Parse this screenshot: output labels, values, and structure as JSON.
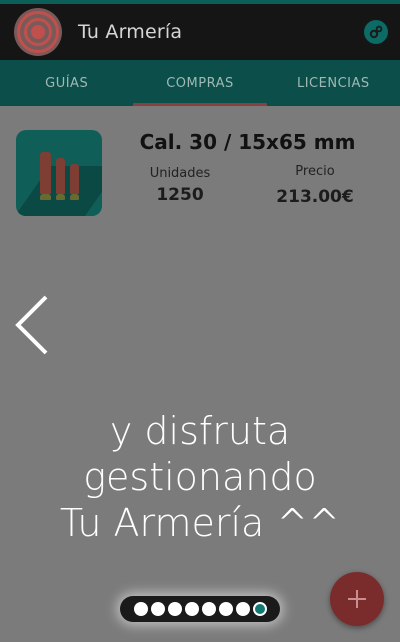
{
  "app": {
    "title": "Tu Armería",
    "logo_icon": "target-icon",
    "settings_icon": "gears-icon"
  },
  "tabs": [
    {
      "label": "GUÍAS",
      "active": false
    },
    {
      "label": "COMPRAS",
      "active": true
    },
    {
      "label": "LICENCIAS",
      "active": false
    }
  ],
  "purchase": {
    "title": "Cal. 30 / 15x65 mm",
    "units_label": "Unidades",
    "units_value": "1250",
    "price_label": "Precio",
    "price_value": "213.00€",
    "icon": "ammo-cartridges-icon"
  },
  "overlay": {
    "line1": "y disfruta",
    "line2": "gestionando",
    "line3": "Tu Armería ^^",
    "back_icon": "chevron-left-icon",
    "pages": 8,
    "current_page": 8
  },
  "fab_icon": "plus-icon",
  "colors": {
    "primary": "#0c4e49",
    "accent": "#7a2c2c",
    "dot_active": "#127872"
  }
}
